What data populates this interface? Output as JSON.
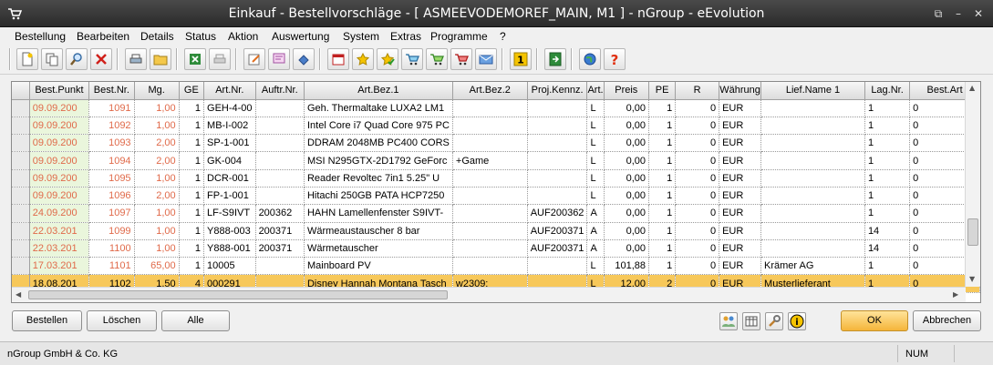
{
  "window": {
    "title": "Einkauf - Bestellvorschläge - [ ASMEEVODEMOREF_MAIN, M1 ]  -  nGroup - eEvolution"
  },
  "menu": [
    "Bestellung",
    "Bearbeiten",
    "Details",
    "Status",
    "Aktion",
    "Auswertung",
    "System",
    "Extras",
    "Programme",
    "?"
  ],
  "toolbar_icons": [
    "new-document-icon",
    "copy-icon",
    "search-icon",
    "delete-icon",
    "print-icon",
    "folder-icon",
    "excel-icon",
    "printer-gray-icon",
    "edit-icon",
    "note-icon",
    "list-icon",
    "calendar-icon",
    "star-icon",
    "star-check-icon",
    "cart-icon",
    "cart-add-icon",
    "cart-remove-icon",
    "mail-icon",
    "number-one-icon",
    "exit-icon",
    "globe-icon",
    "help-icon"
  ],
  "grid": {
    "columns": [
      "Best.Punkt",
      "Best.Nr.",
      "Mg.",
      "GE",
      "Art.Nr.",
      "Auftr.Nr.",
      "Art.Bez.1",
      "Art.Bez.2",
      "Proj.Kennz.",
      "Art.",
      "Preis",
      "PE",
      "R",
      "Währung",
      "Lief.Name 1",
      "Lag.Nr.",
      "Best.Art"
    ],
    "rows": [
      [
        "09.09.200",
        "1091",
        "1,00",
        "1",
        "GEH-4-00",
        "",
        "Geh. Thermaltake LUXA2 LM1",
        "",
        "",
        "L",
        "0,00",
        "1",
        "0",
        "EUR",
        "",
        "1",
        "0"
      ],
      [
        "09.09.200",
        "1092",
        "1,00",
        "1",
        "MB-I-002",
        "",
        "Intel Core i7 Quad Core 975 PC",
        "",
        "",
        "L",
        "0,00",
        "1",
        "0",
        "EUR",
        "",
        "1",
        "0"
      ],
      [
        "09.09.200",
        "1093",
        "2,00",
        "1",
        "SP-1-001",
        "",
        "DDRAM 2048MB PC400 CORS",
        "",
        "",
        "L",
        "0,00",
        "1",
        "0",
        "EUR",
        "",
        "1",
        "0"
      ],
      [
        "09.09.200",
        "1094",
        "2,00",
        "1",
        "GK-004",
        "",
        "MSI N295GTX-2D1792 GeForc",
        "+Game",
        "",
        "L",
        "0,00",
        "1",
        "0",
        "EUR",
        "",
        "1",
        "0"
      ],
      [
        "09.09.200",
        "1095",
        "1,00",
        "1",
        "DCR-001",
        "",
        "Reader Revoltec 7in1 5.25\" U",
        "",
        "",
        "L",
        "0,00",
        "1",
        "0",
        "EUR",
        "",
        "1",
        "0"
      ],
      [
        "09.09.200",
        "1096",
        "2,00",
        "1",
        "FP-1-001",
        "",
        "Hitachi 250GB PATA HCP7250",
        "",
        "",
        "L",
        "0,00",
        "1",
        "0",
        "EUR",
        "",
        "1",
        "0"
      ],
      [
        "24.09.200",
        "1097",
        "1,00",
        "1",
        "LF-S9IVT",
        "200362",
        "HAHN Lamellenfenster S9IVT-",
        "",
        "AUF200362",
        "A",
        "0,00",
        "1",
        "0",
        "EUR",
        "",
        "1",
        "0"
      ],
      [
        "22.03.201",
        "1099",
        "1,00",
        "1",
        "Y888-003",
        "200371",
        "Wärmeaustauscher 8 bar",
        "",
        "AUF200371",
        "A",
        "0,00",
        "1",
        "0",
        "EUR",
        "",
        "14",
        "0"
      ],
      [
        "22.03.201",
        "1100",
        "1,00",
        "1",
        "Y888-001",
        "200371",
        "Wärmetauscher",
        "",
        "AUF200371",
        "A",
        "0,00",
        "1",
        "0",
        "EUR",
        "",
        "14",
        "0"
      ],
      [
        "17.03.201",
        "1101",
        "65,00",
        "1",
        "10005",
        "",
        "Mainboard PV",
        "",
        "",
        "L",
        "101,88",
        "1",
        "0",
        "EUR",
        "Krämer AG",
        "1",
        "0"
      ],
      [
        "18.08.201",
        "1102",
        "1,50",
        "4",
        "000291",
        "",
        "Disney Hannah Montana Tasch",
        "w2309;",
        "",
        "L",
        "12,00",
        "2",
        "0",
        "EUR",
        "Musterlieferant",
        "1",
        "0"
      ]
    ],
    "selected_row": 10
  },
  "buttons": {
    "bestellen": "Bestellen",
    "loeschen": "Löschen",
    "alle": "Alle",
    "ok": "OK",
    "abbrechen": "Abbrechen"
  },
  "status": {
    "company": "nGroup GmbH & Co. KG",
    "num": "NUM"
  }
}
